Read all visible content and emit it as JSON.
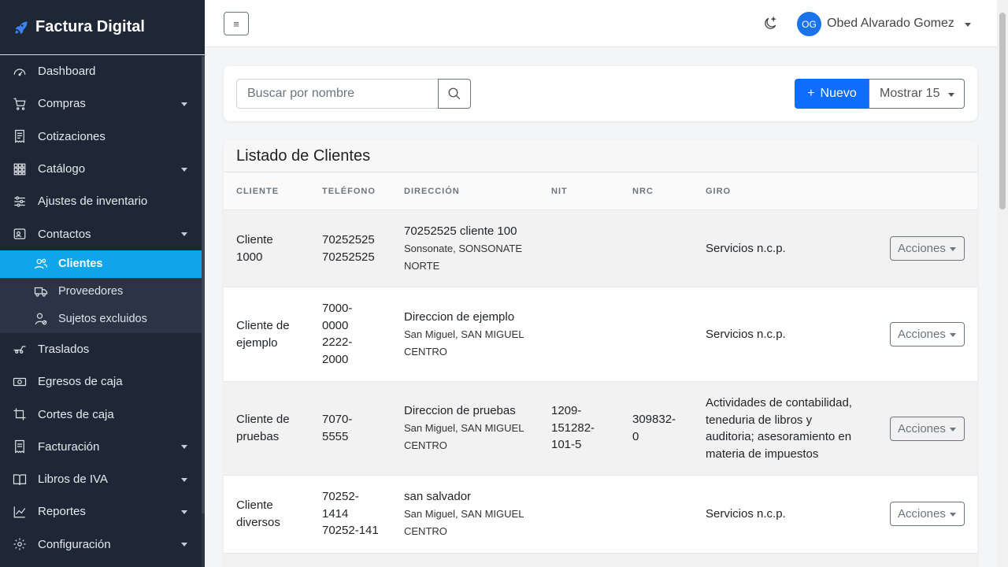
{
  "brand": {
    "name": "Factura Digital"
  },
  "sidebar": {
    "items": [
      {
        "label": "Dashboard",
        "icon": "gauge-icon"
      },
      {
        "label": "Compras",
        "icon": "cart-icon",
        "has_submenu": true
      },
      {
        "label": "Cotizaciones",
        "icon": "receipt-icon"
      },
      {
        "label": "Catálogo",
        "icon": "grid-icon",
        "has_submenu": true
      },
      {
        "label": "Ajustes de inventario",
        "icon": "sliders-icon"
      },
      {
        "label": "Contactos",
        "icon": "contact-card-icon",
        "has_submenu": true,
        "expanded": true
      }
    ],
    "subitems": [
      {
        "label": "Clientes",
        "icon": "users-icon",
        "active": true
      },
      {
        "label": "Proveedores",
        "icon": "truck-icon"
      },
      {
        "label": "Sujetos excluidos",
        "icon": "user-x-icon"
      }
    ],
    "items_after": [
      {
        "label": "Traslados",
        "icon": "dolly-icon"
      },
      {
        "label": "Egresos de caja",
        "icon": "cash-icon"
      },
      {
        "label": "Cortes de caja",
        "icon": "crop-icon"
      },
      {
        "label": "Facturación",
        "icon": "invoice-icon",
        "has_submenu": true
      },
      {
        "label": "Libros de IVA",
        "icon": "book-icon",
        "has_submenu": true
      },
      {
        "label": "Reportes",
        "icon": "chart-line-icon",
        "has_submenu": true
      },
      {
        "label": "Configuración",
        "icon": "gear-icon",
        "has_submenu": true
      }
    ]
  },
  "topbar": {
    "menu_icon": "≡",
    "user_initials": "OG",
    "user_name": "Obed Alvarado Gomez"
  },
  "toolbar": {
    "search_placeholder": "Buscar por nombre",
    "new_label": "Nuevo",
    "show_label": "Mostrar 15"
  },
  "table": {
    "title": "Listado de Clientes",
    "columns": [
      "CLIENTE",
      "TELÉFONO",
      "DIRECCIÓN",
      "NIT",
      "NRC",
      "GIRO"
    ],
    "rows": [
      {
        "cliente": [
          "Cliente",
          "1000"
        ],
        "telefono": [
          "70252525",
          "70252525"
        ],
        "direccion": "70252525 cliente 100",
        "ubicacion": [
          "Sonsonate, SONSONATE",
          "NORTE"
        ],
        "nit": [],
        "nrc": [],
        "giro": [
          "Servicios n.c.p."
        ],
        "accion": "Acciones"
      },
      {
        "cliente": [
          "Cliente de",
          "ejemplo"
        ],
        "telefono": [
          "7000-",
          "0000",
          "2222-",
          "2000"
        ],
        "direccion": "Direccion de ejemplo",
        "ubicacion": [
          "San Miguel, SAN MIGUEL",
          "CENTRO"
        ],
        "nit": [],
        "nrc": [],
        "giro": [
          "Servicios n.c.p."
        ],
        "accion": "Acciones"
      },
      {
        "cliente": [
          "Cliente de",
          "pruebas"
        ],
        "telefono": [
          "7070-",
          "5555"
        ],
        "direccion": "Direccion de pruebas",
        "ubicacion": [
          "San Miguel, SAN MIGUEL",
          "CENTRO"
        ],
        "nit": [
          "1209-",
          "151282-",
          "101-5"
        ],
        "nrc": [
          "309832-",
          "0"
        ],
        "giro": [
          "Actividades de contabilidad,",
          "teneduria de libros y",
          "auditoria; asesoramiento en",
          "materia de impuestos"
        ],
        "accion": "Acciones"
      },
      {
        "cliente": [
          "Cliente",
          "diversos"
        ],
        "telefono": [
          "70252-",
          "1414",
          "70252-141"
        ],
        "direccion": "san salvador",
        "ubicacion": [
          "San Miguel, SAN MIGUEL",
          "CENTRO"
        ],
        "nit": [],
        "nrc": [],
        "giro": [
          "Servicios n.c.p."
        ],
        "accion": "Acciones"
      }
    ]
  },
  "colors": {
    "sidebar_bg": "#1d2735",
    "active_item": "#0ea5e9",
    "primary": "#0d6efd"
  }
}
